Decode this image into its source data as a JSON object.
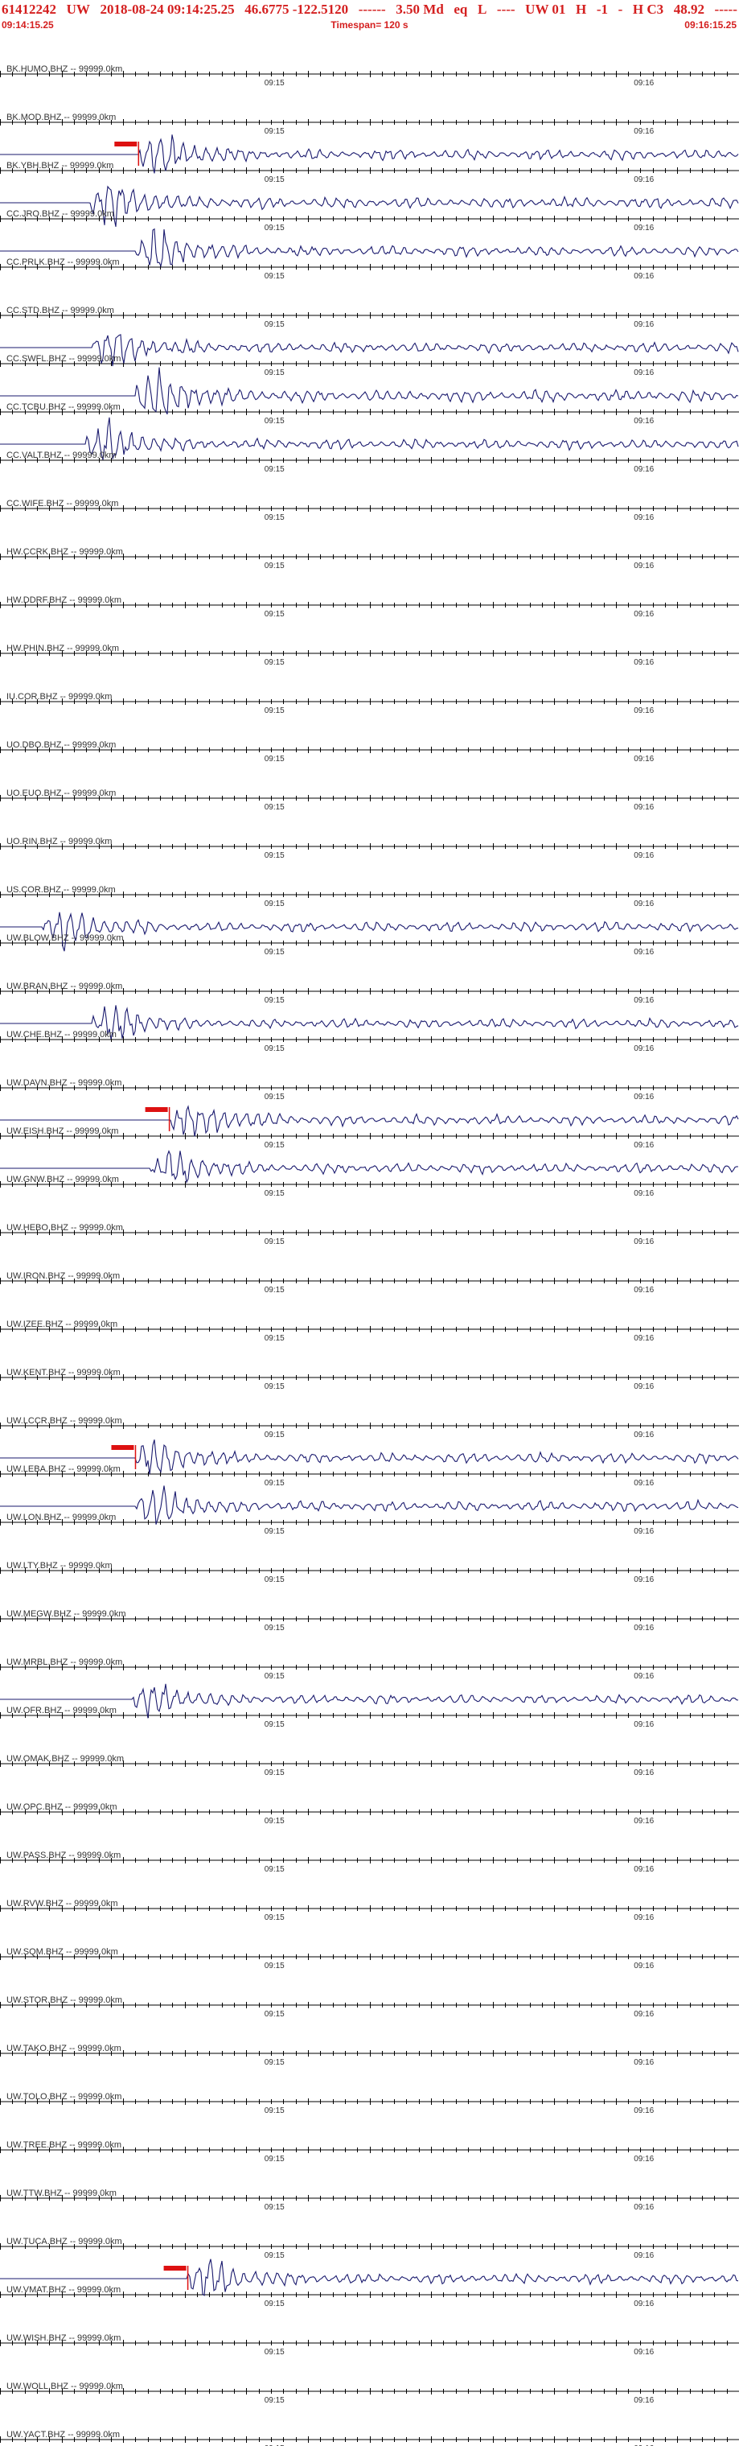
{
  "header": {
    "title_parts": [
      "61412242",
      "UW",
      "2018-08-24 09:14:25.25",
      "46.6775 -122.5120",
      "------",
      "3.50 Md",
      "eq",
      "L",
      "----",
      "UW 01",
      "H",
      "-1",
      "-",
      "H C3",
      "48.92",
      "-----"
    ],
    "start_time": "09:14:15.25",
    "timespan": "Timespan= 120 s",
    "end_time": "09:16:15.25"
  },
  "chart_data": {
    "type": "line",
    "title": "61412242 UW 2018-08-24 09:14:25.25 46.6775 -122.5120 ------ 3.50 Md eq L ---- UW 01 H -1 - H C3 48.92 -----",
    "x_unit": "seconds after 09:14:15.25",
    "xlim": [
      0,
      120
    ],
    "tick_labels": [
      "09:15",
      "09:16"
    ],
    "tick_label_seconds": [
      44.75,
      104.75
    ],
    "colors": {
      "header_text": "#d41f1f",
      "trace": "#1a1a6e",
      "pick_marker": "#dd1111",
      "axis": "#000000",
      "label_text": "#333333"
    },
    "grid": false,
    "stations": [
      {
        "label": "BK.HUMO.BHZ -- 99999.0km",
        "pick": null,
        "onset": null,
        "amp": 0
      },
      {
        "label": "BK.MOD.BHZ -- 99999.0km",
        "pick": null,
        "onset": null,
        "amp": 0
      },
      {
        "label": "BK.YBH.BHZ -- 99999.0km",
        "pick": 22.5,
        "onset": 22.5,
        "amp": 1.0
      },
      {
        "label": "CC.JRO.BHZ -- 99999.0km",
        "pick": null,
        "onset": 14.5,
        "amp": 1.1
      },
      {
        "label": "CC.PRLK.BHZ -- 99999.0km",
        "pick": null,
        "onset": 22.0,
        "amp": 1.0
      },
      {
        "label": "CC.STD.BHZ -- 99999.0km",
        "pick": null,
        "onset": null,
        "amp": 0
      },
      {
        "label": "CC.SWFL.BHZ -- 99999.0km",
        "pick": null,
        "onset": 15.0,
        "amp": 1.0
      },
      {
        "label": "CC.TCBU.BHZ -- 99999.0km",
        "pick": null,
        "onset": 22.0,
        "amp": 1.2
      },
      {
        "label": "CC.VALT.BHZ -- 99999.0km",
        "pick": null,
        "onset": 14.0,
        "amp": 1.0
      },
      {
        "label": "CC.WIFE.BHZ -- 99999.0km",
        "pick": null,
        "onset": null,
        "amp": 0
      },
      {
        "label": "HW.CCRK.BHZ -- 99999.0km",
        "pick": null,
        "onset": null,
        "amp": 0
      },
      {
        "label": "HW.DDRF.BHZ -- 99999.0km",
        "pick": null,
        "onset": null,
        "amp": 0
      },
      {
        "label": "HW.PHIN.BHZ -- 99999.0km",
        "pick": null,
        "onset": null,
        "amp": 0
      },
      {
        "label": "IU.COR.BHZ -- 99999.0km",
        "pick": null,
        "onset": null,
        "amp": 0
      },
      {
        "label": "UO.DBO.BHZ -- 99999.0km",
        "pick": null,
        "onset": null,
        "amp": 0
      },
      {
        "label": "UO.EUO.BHZ -- 99999.0km",
        "pick": null,
        "onset": null,
        "amp": 0
      },
      {
        "label": "UO.RIN.BHZ -- 99999.0km",
        "pick": null,
        "onset": null,
        "amp": 0
      },
      {
        "label": "US.COR.BHZ -- 99999.0km",
        "pick": null,
        "onset": null,
        "amp": 0
      },
      {
        "label": "UW.BLOW.BHZ -- 99999.0km",
        "pick": null,
        "onset": 7.0,
        "amp": 1.0
      },
      {
        "label": "UW.BRAN.BHZ -- 99999.0km",
        "pick": null,
        "onset": null,
        "amp": 0
      },
      {
        "label": "UW.CHE.BHZ -- 99999.0km",
        "pick": null,
        "onset": 15.0,
        "amp": 0.9
      },
      {
        "label": "UW.DAVN.BHZ -- 99999.0km",
        "pick": null,
        "onset": null,
        "amp": 0
      },
      {
        "label": "UW.EISH.BHZ -- 99999.0km",
        "pick": 27.5,
        "onset": 27.5,
        "amp": 1.0
      },
      {
        "label": "UW.GNW.BHZ -- 99999.0km",
        "pick": null,
        "onset": 24.5,
        "amp": 1.0
      },
      {
        "label": "UW.HEBO.BHZ -- 99999.0km",
        "pick": null,
        "onset": null,
        "amp": 0
      },
      {
        "label": "UW.IRON.BHZ -- 99999.0km",
        "pick": null,
        "onset": null,
        "amp": 0
      },
      {
        "label": "UW.IZEE.BHZ -- 99999.0km",
        "pick": null,
        "onset": null,
        "amp": 0
      },
      {
        "label": "UW.KENT.BHZ -- 99999.0km",
        "pick": null,
        "onset": null,
        "amp": 0
      },
      {
        "label": "UW.LCCR.BHZ -- 99999.0km",
        "pick": null,
        "onset": null,
        "amp": 0
      },
      {
        "label": "UW.LEBA.BHZ -- 99999.0km",
        "pick": 22.0,
        "onset": 22.0,
        "amp": 1.0
      },
      {
        "label": "UW.LON.BHZ -- 99999.0km",
        "pick": null,
        "onset": 22.0,
        "amp": 1.0
      },
      {
        "label": "UW.LTY.BHZ -- 99999.0km",
        "pick": null,
        "onset": null,
        "amp": 0
      },
      {
        "label": "UW.MEGW.BHZ -- 99999.0km",
        "pick": null,
        "onset": null,
        "amp": 0
      },
      {
        "label": "UW.MRBL.BHZ -- 99999.0km",
        "pick": null,
        "onset": null,
        "amp": 0
      },
      {
        "label": "UW.OFR.BHZ -- 99999.0km",
        "pick": null,
        "onset": 21.5,
        "amp": 0.9
      },
      {
        "label": "UW.OMAK.BHZ -- 99999.0km",
        "pick": null,
        "onset": null,
        "amp": 0
      },
      {
        "label": "UW.OPC.BHZ -- 99999.0km",
        "pick": null,
        "onset": null,
        "amp": 0
      },
      {
        "label": "UW.PASS.BHZ -- 99999.0km",
        "pick": null,
        "onset": null,
        "amp": 0
      },
      {
        "label": "UW.RVW.BHZ -- 99999.0km",
        "pick": null,
        "onset": null,
        "amp": 0
      },
      {
        "label": "UW.SQM.BHZ -- 99999.0km",
        "pick": null,
        "onset": null,
        "amp": 0
      },
      {
        "label": "UW.STOR.BHZ -- 99999.0km",
        "pick": null,
        "onset": null,
        "amp": 0
      },
      {
        "label": "UW.TAKO.BHZ -- 99999.0km",
        "pick": null,
        "onset": null,
        "amp": 0
      },
      {
        "label": "UW.TOLO.BHZ -- 99999.0km",
        "pick": null,
        "onset": null,
        "amp": 0
      },
      {
        "label": "UW.TREE.BHZ -- 99999.0km",
        "pick": null,
        "onset": null,
        "amp": 0
      },
      {
        "label": "UW.TTW.BHZ -- 99999.0km",
        "pick": null,
        "onset": null,
        "amp": 0
      },
      {
        "label": "UW.TUCA.BHZ -- 99999.0km",
        "pick": null,
        "onset": null,
        "amp": 0
      },
      {
        "label": "UW.VMAT.BHZ -- 99999.0km",
        "pick": 30.5,
        "onset": 30.5,
        "amp": 1.0
      },
      {
        "label": "UW.WISH.BHZ -- 99999.0km",
        "pick": null,
        "onset": null,
        "amp": 0
      },
      {
        "label": "UW.WOLL.BHZ -- 99999.0km",
        "pick": null,
        "onset": null,
        "amp": 0
      },
      {
        "label": "UW.YACT.BHZ -- 99999.0km",
        "pick": null,
        "onset": null,
        "amp": 0
      }
    ]
  }
}
